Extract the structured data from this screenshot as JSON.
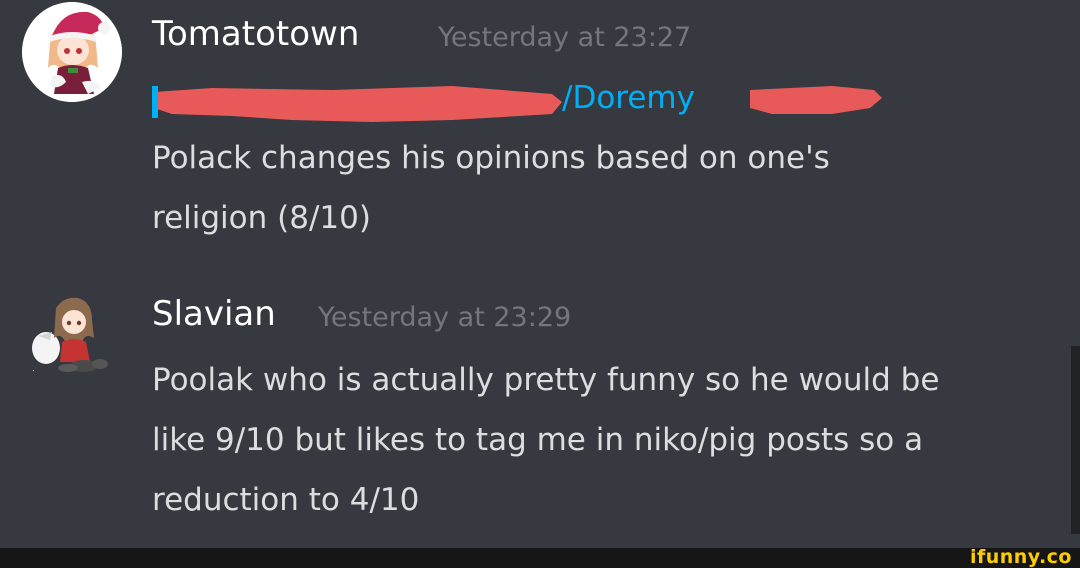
{
  "messages": [
    {
      "username": "Tomatotown",
      "timestamp": "Yesterday at 23:27",
      "link_visible": "/Doremy",
      "lines": [
        "Polack changes his opinions based on one's",
        "religion (8/10)"
      ]
    },
    {
      "username": "Slavian",
      "timestamp": "Yesterday at 23:29",
      "lines": [
        "Poolak who is actually pretty funny so he would be",
        "like 9/10 but likes to tag me in niko/pig posts so a",
        "reduction to 4/10"
      ]
    }
  ],
  "watermark": "ifunny.co",
  "colors": {
    "background": "#36393f",
    "username": "#ffffff",
    "timestamp": "#72767d",
    "text": "#dcddde",
    "link": "#00aff4",
    "redaction": "#e85a5a",
    "watermark": "#ffcc00"
  },
  "icons": {
    "avatar_1": "santa-hat-anime-girl-avatar",
    "avatar_2": "sitting-anime-girl-avatar"
  }
}
